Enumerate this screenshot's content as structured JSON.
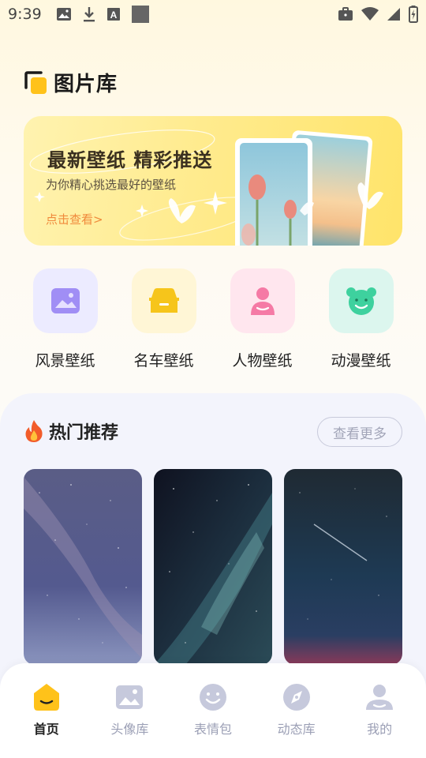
{
  "status_bar": {
    "time": "9:39"
  },
  "header": {
    "title": "图片库"
  },
  "banner": {
    "title": "最新壁纸 精彩推送",
    "subtitle": "为你精心挑选最好的壁纸",
    "cta": "点击查看>"
  },
  "categories": [
    {
      "label": "风景壁纸",
      "icon": "landscape-icon",
      "bg": "#ecebff",
      "color": "#8e7cf0"
    },
    {
      "label": "名车壁纸",
      "icon": "car-icon",
      "bg": "#fff6d6",
      "color": "#f6c51b"
    },
    {
      "label": "人物壁纸",
      "icon": "person-icon",
      "bg": "#ffe6ee",
      "color": "#f57aa5"
    },
    {
      "label": "动漫壁纸",
      "icon": "bear-icon",
      "bg": "#dcf6ee",
      "color": "#3ed19e"
    }
  ],
  "hot": {
    "title": "热门推荐",
    "more": "查看更多"
  },
  "nav": [
    {
      "label": "首页",
      "icon": "home-icon",
      "active": true
    },
    {
      "label": "头像库",
      "icon": "image-icon",
      "active": false
    },
    {
      "label": "表情包",
      "icon": "smile-icon",
      "active": false
    },
    {
      "label": "动态库",
      "icon": "compass-icon",
      "active": false
    },
    {
      "label": "我的",
      "icon": "user-icon",
      "active": false
    }
  ],
  "colors": {
    "accent": "#ffc21a",
    "nav_inactive": "#c6c9dc"
  }
}
